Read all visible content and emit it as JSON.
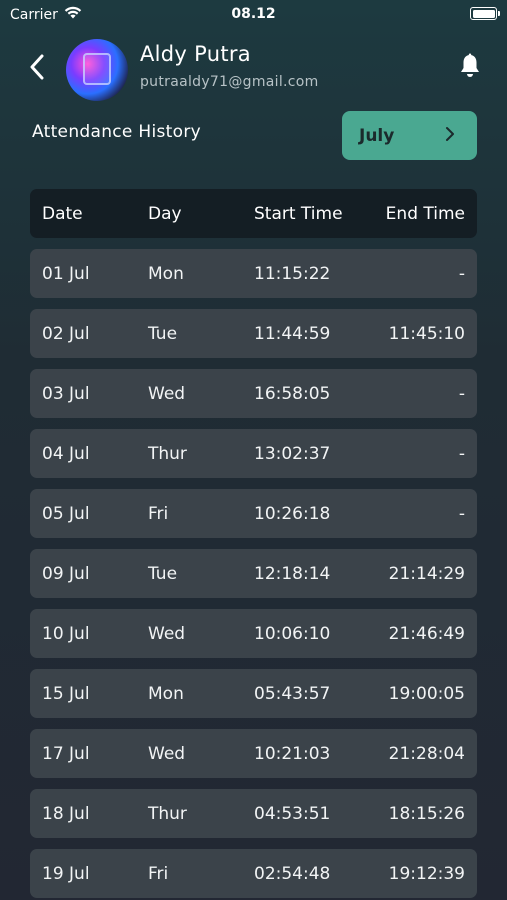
{
  "status_bar": {
    "carrier": "Carrier",
    "time": "08.12",
    "wifi_icon": "wifi-icon",
    "battery_icon": "battery-icon"
  },
  "header": {
    "back_icon": "chevron-left-icon",
    "user_name": "Aldy Putra",
    "email": "putraaldy71@gmail.com",
    "notification_icon": "bell-icon"
  },
  "attendance": {
    "title": "Attendance History",
    "month": "July",
    "month_icon": "chevron-right-icon",
    "accent_color": "#4aa891"
  },
  "table": {
    "columns": [
      "Date",
      "Day",
      "Start Time",
      "End Time"
    ],
    "rows": [
      {
        "date": "01 Jul",
        "day": "Mon",
        "start": "11:15:22",
        "end": "-"
      },
      {
        "date": "02 Jul",
        "day": "Tue",
        "start": "11:44:59",
        "end": "11:45:10"
      },
      {
        "date": "03 Jul",
        "day": "Wed",
        "start": "16:58:05",
        "end": "-"
      },
      {
        "date": "04 Jul",
        "day": "Thur",
        "start": "13:02:37",
        "end": "-"
      },
      {
        "date": "05 Jul",
        "day": "Fri",
        "start": "10:26:18",
        "end": "-"
      },
      {
        "date": "09 Jul",
        "day": "Tue",
        "start": "12:18:14",
        "end": "21:14:29"
      },
      {
        "date": "10 Jul",
        "day": "Wed",
        "start": "10:06:10",
        "end": "21:46:49"
      },
      {
        "date": "15 Jul",
        "day": "Mon",
        "start": "05:43:57",
        "end": "19:00:05"
      },
      {
        "date": "17 Jul",
        "day": "Wed",
        "start": "10:21:03",
        "end": "21:28:04"
      },
      {
        "date": "18 Jul",
        "day": "Thur",
        "start": "04:53:51",
        "end": "18:15:26"
      },
      {
        "date": "19 Jul",
        "day": "Fri",
        "start": "02:54:48",
        "end": "19:12:39"
      }
    ]
  }
}
